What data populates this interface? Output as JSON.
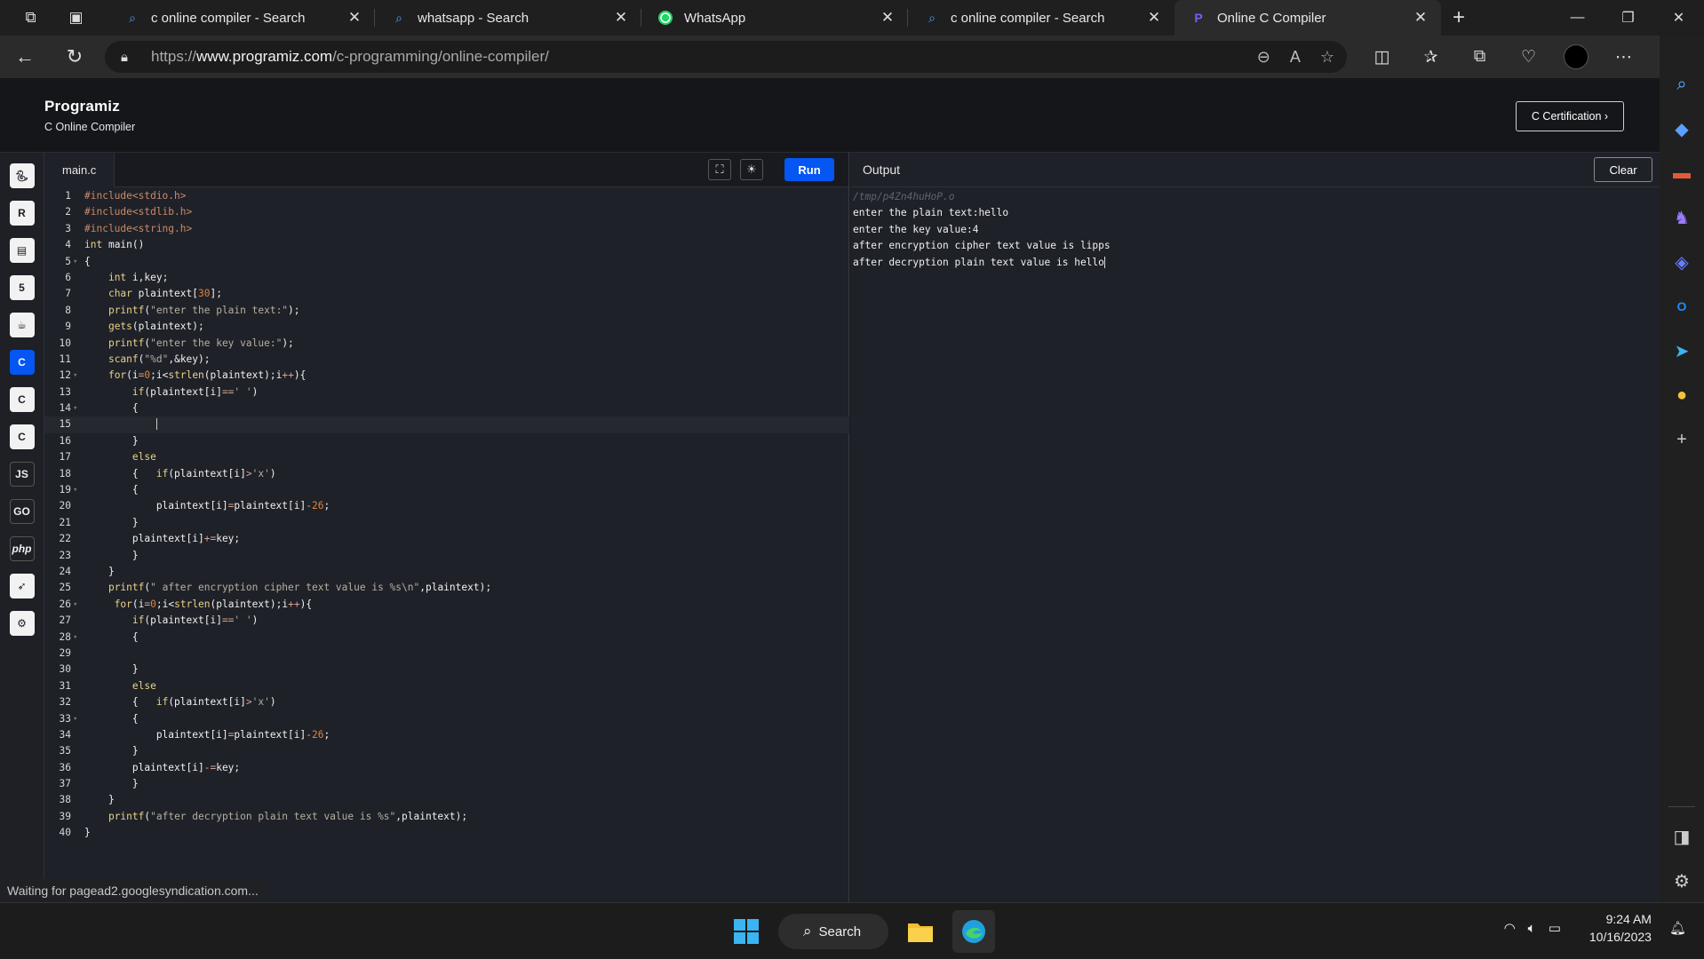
{
  "browser": {
    "tabs": [
      {
        "title": "c online compiler - Search",
        "icon": "search-icon"
      },
      {
        "title": "whatsapp - Search",
        "icon": "search-icon"
      },
      {
        "title": "WhatsApp",
        "icon": "whatsapp-icon"
      },
      {
        "title": "c online compiler - Search",
        "icon": "search-icon"
      },
      {
        "title": "Online C Compiler",
        "icon": "programiz-icon"
      }
    ],
    "url_prefix": "https://",
    "url_host": "www.programiz.com",
    "url_path": "/c-programming/online-compiler/"
  },
  "site": {
    "logo": "Programiz",
    "subtitle": "C Online Compiler",
    "cert_button": "C Certification ›"
  },
  "languages": [
    "python",
    "r",
    "sql",
    "html",
    "java",
    "c",
    "c++",
    "c#",
    "JS",
    "go",
    "php",
    "swift",
    "rust"
  ],
  "editor": {
    "file_tab": "main.c",
    "run_label": "Run"
  },
  "output": {
    "title": "Output",
    "clear_label": "Clear",
    "path": "/tmp/p4Zn4huHoP.o",
    "lines": [
      "enter the plain text:hello",
      "enter the key value:4",
      "after encryption cipher text value is lipps",
      "after decryption plain text value is hello"
    ]
  },
  "status_tip": "Waiting for pagead2.googlesyndication.com...",
  "taskbar": {
    "search_label": "Search",
    "time": "9:24 AM",
    "date": "10/16/2023"
  },
  "colors": {
    "accent": "#0556f3",
    "page_bg": "#1a1b20",
    "editor_bg": "#1f2128"
  }
}
